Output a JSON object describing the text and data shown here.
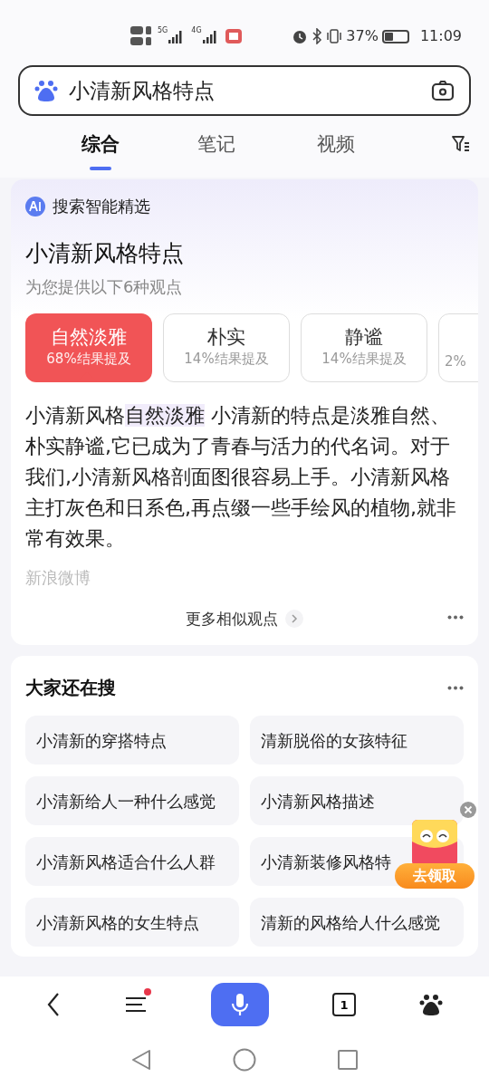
{
  "status_bar": {
    "network_1": "5G",
    "network_2": "4G",
    "battery": "37%",
    "time": "11:09"
  },
  "search": {
    "value": "小清新风格特点"
  },
  "tabs": [
    {
      "label": "综合",
      "selected": true
    },
    {
      "label": "笔记",
      "selected": false
    },
    {
      "label": "视频",
      "selected": false
    }
  ],
  "ai_card": {
    "badge": "搜索智能精选",
    "title": "小清新风格特点",
    "subtitle": "为您提供以下6种观点",
    "viewpoints": [
      {
        "label": "自然淡雅",
        "share": "68%结果提及",
        "selected": true
      },
      {
        "label": "朴实",
        "share": "14%结果提及",
        "selected": false
      },
      {
        "label": "静谧",
        "share": "14%结果提及",
        "selected": false
      },
      {
        "share": "2%",
        "selected": false
      }
    ],
    "body": "小清新风格**自然淡雅** 小清新的特点是淡雅自然、朴实静谧,它已成为了青春与活力的代名词。对于我们,小清新风格剖面图很容易上手。小清新风格主打灰色和日系色,再点缀一些手绘风的植物,就非常有效果。",
    "source": "新浪微博",
    "more": "更多相似观点"
  },
  "related": {
    "title": "大家还在搜",
    "items": [
      "小清新的穿搭特点",
      "清新脱俗的女孩特征",
      "小清新给人一种什么感觉",
      "小清新风格描述",
      "小清新风格适合什么人群",
      "小清新装修风格特",
      "小清新风格的女生特点",
      "清新的风格给人什么感觉"
    ]
  },
  "promo": {
    "label": "去领取"
  },
  "bottom_nav": {
    "tab_count": "1",
    "menu_badge": true
  }
}
